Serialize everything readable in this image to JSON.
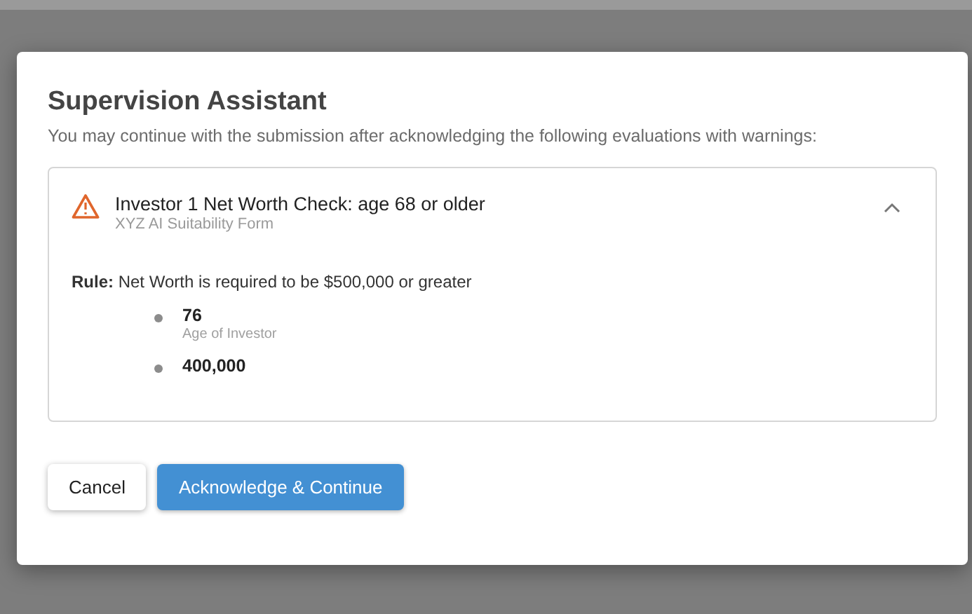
{
  "dialog": {
    "title": "Supervision Assistant",
    "message": "You may continue with the submission after acknowledging the following evaluations with warnings:",
    "evaluations": [
      {
        "title": "Investor 1 Net Worth Check: age 68 or older",
        "source": "XYZ AI Suitability Form",
        "expanded": true,
        "rule": "**Rule:** Net Worth is required to be $500,000 or greater",
        "facts": [
          {
            "value": "76",
            "label": "Age of Investor"
          },
          {
            "value": "400,000"
          }
        ]
      }
    ],
    "buttons": [
      {
        "label": "Cancel",
        "kind": "secondary"
      },
      {
        "label": "Acknowledge & Continue",
        "kind": "primary"
      }
    ]
  }
}
